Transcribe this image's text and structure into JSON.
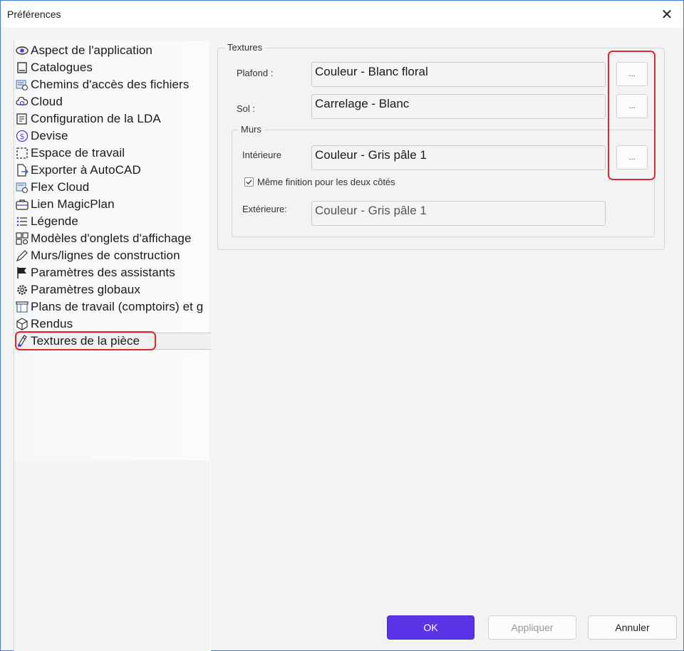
{
  "window": {
    "title": "Préférences",
    "close_glyph": "✕"
  },
  "sidebar": {
    "items": [
      {
        "label": "Aspect de l'application",
        "icon": "eye-icon"
      },
      {
        "label": "Catalogues",
        "icon": "catalog-icon"
      },
      {
        "label": "Chemins d'accès des fichiers",
        "icon": "file-paths-icon"
      },
      {
        "label": "Cloud",
        "icon": "cloud-icon"
      },
      {
        "label": "Configuration de la LDA",
        "icon": "config-icon"
      },
      {
        "label": "Devise",
        "icon": "currency-icon"
      },
      {
        "label": "Espace de travail",
        "icon": "workspace-icon"
      },
      {
        "label": "Exporter à AutoCAD",
        "icon": "export-icon"
      },
      {
        "label": "Flex Cloud",
        "icon": "flex-cloud-icon"
      },
      {
        "label": "Lien MagicPlan",
        "icon": "magicplan-icon"
      },
      {
        "label": "Légende",
        "icon": "legend-icon"
      },
      {
        "label": "Modèles d'onglets d'affichage",
        "icon": "view-tabs-icon"
      },
      {
        "label": "Murs/lignes de construction",
        "icon": "pencil-icon"
      },
      {
        "label": "Paramètres des assistants",
        "icon": "flag-icon"
      },
      {
        "label": "Paramètres globaux",
        "icon": "gear-icon"
      },
      {
        "label": "Plans de travail (comptoirs) et g",
        "icon": "countertop-icon"
      },
      {
        "label": "Rendus",
        "icon": "cube-icon"
      },
      {
        "label": "Textures de la pièce",
        "icon": "texture-brush-icon",
        "selected": true
      }
    ]
  },
  "textures": {
    "legend": "Textures",
    "plafond": {
      "label": "Plafond :",
      "value": "Couleur - Blanc floral"
    },
    "sol": {
      "label": "Sol :",
      "value": "Carrelage - Blanc"
    },
    "murs": {
      "legend": "Murs",
      "interieure": {
        "label": "Intérieure",
        "value": "Couleur - Gris pâle 1"
      },
      "same_finish": {
        "label": "Même finition pour les deux côtés",
        "checked": true
      },
      "exterieure": {
        "label": "Extérieure:",
        "value": "Couleur - Gris pâle 1"
      }
    },
    "browse_label": "..."
  },
  "footer": {
    "ok": "OK",
    "apply": "Appliquer",
    "cancel": "Annuler"
  },
  "colors": {
    "accent": "#5a34e6",
    "highlight": "#e3252d",
    "window_border": "#3b78d8"
  }
}
